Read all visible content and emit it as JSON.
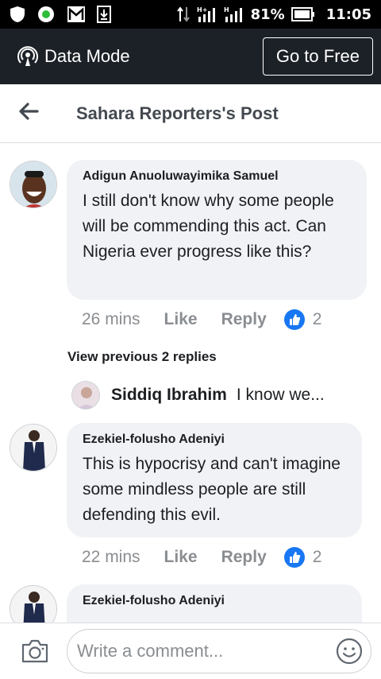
{
  "status_bar": {
    "battery_percent": "81%",
    "time": "11:05",
    "icons": [
      "shield-icon",
      "status-dot-icon",
      "gmail-icon",
      "download-icon",
      "data-arrows-icon",
      "signal-h-icon",
      "signal-h-icon-2",
      "battery-icon"
    ]
  },
  "data_mode": {
    "label": "Data Mode",
    "button": "Go to Free",
    "icon": "broadcast-icon"
  },
  "header": {
    "title": "Sahara Reporters's Post",
    "back_icon": "back-arrow-icon"
  },
  "comments": [
    {
      "author": "Adigun Anuoluwayimika Samuel",
      "text": "I still don't know why some people will be commending this act. Can Nigeria ever progress like this?",
      "time": "26 mins",
      "like": "Like",
      "reply": "Reply",
      "reactions": "2"
    },
    {
      "author": "Ezekiel-folusho Adeniyi",
      "text": "This is hypocrisy and can't imagine some mindless people are still defending this evil.",
      "time": "22 mins",
      "like": "Like",
      "reply": "Reply",
      "reactions": "2"
    },
    {
      "author": "Ezekiel-folusho Adeniyi"
    }
  ],
  "replies": {
    "view_previous": "View previous 2 replies",
    "preview_name": "Siddiq Ibrahim",
    "preview_text": "I know we..."
  },
  "composer": {
    "placeholder": "Write a comment...",
    "icons": [
      "camera-icon",
      "emoji-icon"
    ]
  },
  "colors": {
    "status_bar_bg": "#000000",
    "data_mode_bg": "#1c2127",
    "bubble_bg": "#f0f2f5",
    "like_blue": "#1877f2",
    "muted_text": "#8a8d91"
  }
}
